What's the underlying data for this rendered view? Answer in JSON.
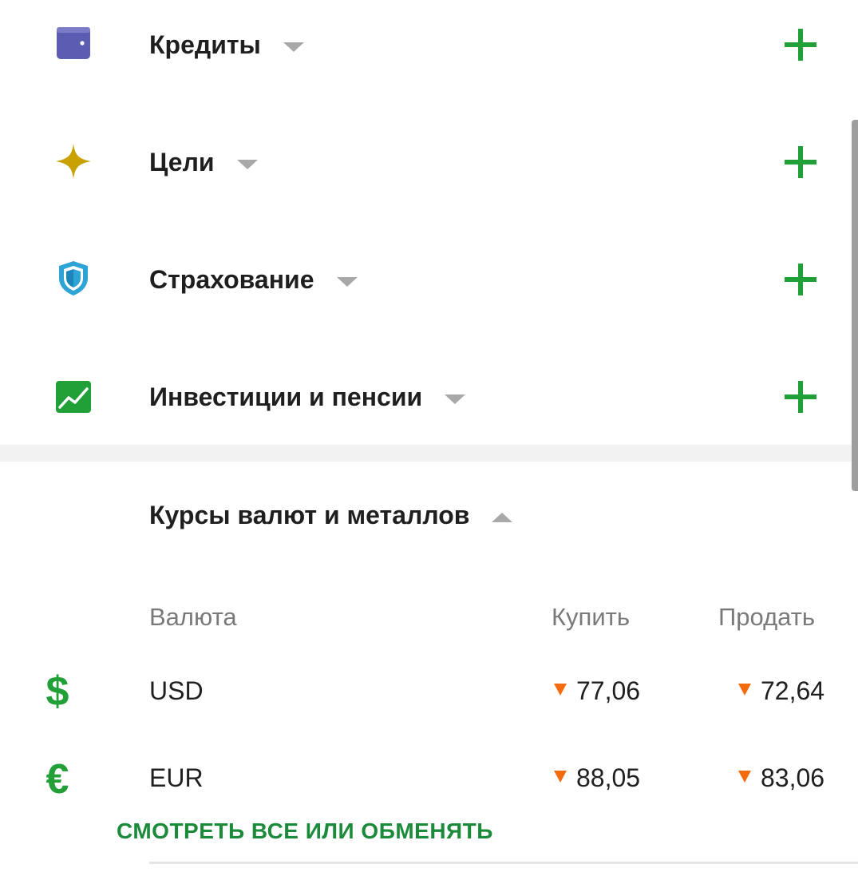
{
  "sections": [
    {
      "title": "Кредиты",
      "icon": "wallet-icon",
      "color": "#5b5db3"
    },
    {
      "title": "Цели",
      "icon": "star-icon",
      "color": "#c9a100"
    },
    {
      "title": "Страхование",
      "icon": "shield-icon",
      "color": "#2ea3d6"
    },
    {
      "title": "Инвестиции и пенсии",
      "icon": "chart-icon",
      "color": "#21a038"
    }
  ],
  "rates": {
    "title": "Курсы валют и металлов",
    "headers": {
      "currency": "Валюта",
      "buy": "Купить",
      "sell": "Продать"
    },
    "rows": [
      {
        "symbol": "$",
        "code": "USD",
        "buy": "77,06",
        "sell": "72,64",
        "trend": "down"
      },
      {
        "symbol": "€",
        "code": "EUR",
        "buy": "88,05",
        "sell": "83,06",
        "trend": "down"
      }
    ],
    "link": "СМОТРЕТЬ ВСЕ ИЛИ ОБМЕНЯТЬ"
  },
  "colors": {
    "accent": "#21a038",
    "trend_down": "#f26b0f"
  }
}
